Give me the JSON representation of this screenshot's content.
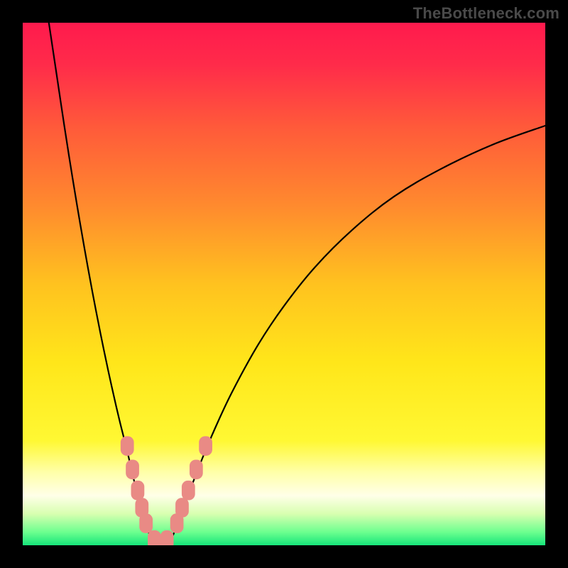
{
  "watermark": "TheBottleneck.com",
  "colors": {
    "background": "#000000",
    "gradient_stops": [
      {
        "offset": 0.0,
        "color": "#ff1a4d"
      },
      {
        "offset": 0.08,
        "color": "#ff2b4a"
      },
      {
        "offset": 0.2,
        "color": "#ff5a3a"
      },
      {
        "offset": 0.35,
        "color": "#ff8a2e"
      },
      {
        "offset": 0.5,
        "color": "#ffc21f"
      },
      {
        "offset": 0.65,
        "color": "#ffe61a"
      },
      {
        "offset": 0.8,
        "color": "#fff833"
      },
      {
        "offset": 0.86,
        "color": "#ffffa8"
      },
      {
        "offset": 0.905,
        "color": "#ffffe8"
      },
      {
        "offset": 0.94,
        "color": "#d8ffb0"
      },
      {
        "offset": 0.975,
        "color": "#6cff8f"
      },
      {
        "offset": 1.0,
        "color": "#16e57a"
      }
    ],
    "curve": "#000000",
    "marker_fill": "#e98a85",
    "marker_stroke": "#e98a85"
  },
  "chart_data": {
    "type": "line",
    "title": "",
    "xlabel": "",
    "ylabel": "",
    "xlim": [
      0,
      100
    ],
    "ylim": [
      0,
      100
    ],
    "series": [
      {
        "name": "curve-left",
        "x": [
          5.0,
          6.5,
          8.0,
          9.5,
          11.0,
          12.5,
          14.0,
          15.5,
          17.0,
          18.5,
          20.0,
          21.2,
          22.3,
          23.3,
          24.0,
          24.7
        ],
        "y": [
          100.0,
          90.0,
          80.0,
          70.5,
          61.5,
          53.0,
          45.0,
          37.5,
          30.5,
          24.0,
          18.0,
          12.8,
          8.5,
          5.2,
          2.8,
          1.0
        ]
      },
      {
        "name": "curve-flat",
        "x": [
          24.7,
          25.6,
          26.5,
          27.4,
          28.3
        ],
        "y": [
          1.0,
          0.6,
          0.5,
          0.6,
          1.0
        ]
      },
      {
        "name": "curve-right",
        "x": [
          28.3,
          29.2,
          30.4,
          32.0,
          34.0,
          36.5,
          40.0,
          45.0,
          50.0,
          56.0,
          63.0,
          71.0,
          80.0,
          90.0,
          100.0
        ],
        "y": [
          1.0,
          3.0,
          6.2,
          10.5,
          15.7,
          21.7,
          29.2,
          38.3,
          45.8,
          53.3,
          60.3,
          66.7,
          72.0,
          76.7,
          80.3
        ]
      }
    ],
    "markers": {
      "name": "data-points",
      "shape": "rounded-rect",
      "points": [
        {
          "x": 20.0,
          "y": 19.0
        },
        {
          "x": 21.0,
          "y": 14.5
        },
        {
          "x": 22.0,
          "y": 10.5
        },
        {
          "x": 22.8,
          "y": 7.2
        },
        {
          "x": 23.6,
          "y": 4.2
        },
        {
          "x": 25.2,
          "y": 1.0
        },
        {
          "x": 27.6,
          "y": 1.0
        },
        {
          "x": 29.5,
          "y": 4.2
        },
        {
          "x": 30.5,
          "y": 7.2
        },
        {
          "x": 31.7,
          "y": 10.5
        },
        {
          "x": 33.2,
          "y": 14.5
        },
        {
          "x": 35.0,
          "y": 19.0
        }
      ]
    }
  }
}
